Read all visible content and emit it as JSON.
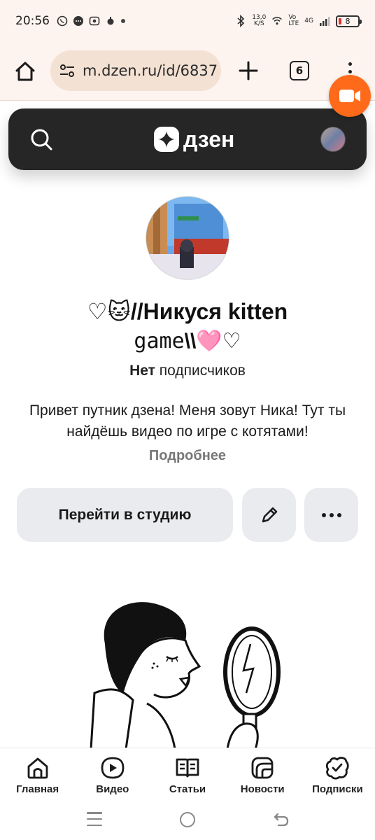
{
  "status_bar": {
    "time": "20:56",
    "net_speed_value": "13,0",
    "net_speed_unit": "K/S",
    "volte_top": "Vo",
    "volte_bottom": "LTE",
    "network": "4G",
    "battery": "8"
  },
  "browser": {
    "url": "m.dzen.ru/id/6837",
    "tab_count": "6"
  },
  "dzen_header": {
    "logo_text": "дзен"
  },
  "profile": {
    "title_line1": "♡🐱//Никуся kitten",
    "title_line2_mono": "game",
    "title_line2_rest": "\\\\🩷♡",
    "subscribers_bold": "Нет",
    "subscribers_rest": " подписчиков",
    "description": "Привет путник дзена! Меня зовут Ника! Тут ты найдёшь видео по игре с котятами!",
    "more_link": "Подробнее"
  },
  "actions": {
    "studio_button": "Перейти в студию"
  },
  "bottom_nav": {
    "items": [
      {
        "label": "Главная",
        "icon": "home-icon"
      },
      {
        "label": "Видео",
        "icon": "video-icon"
      },
      {
        "label": "Статьи",
        "icon": "articles-icon"
      },
      {
        "label": "Новости",
        "icon": "news-icon"
      },
      {
        "label": "Подписки",
        "icon": "subscriptions-icon"
      }
    ]
  },
  "colors": {
    "browser_bg": "#fdf4ef",
    "url_pill": "#f3e1d3",
    "dzen_header": "#262626",
    "button_bg": "#eaebef",
    "record_fab": "#ff6a1a"
  }
}
